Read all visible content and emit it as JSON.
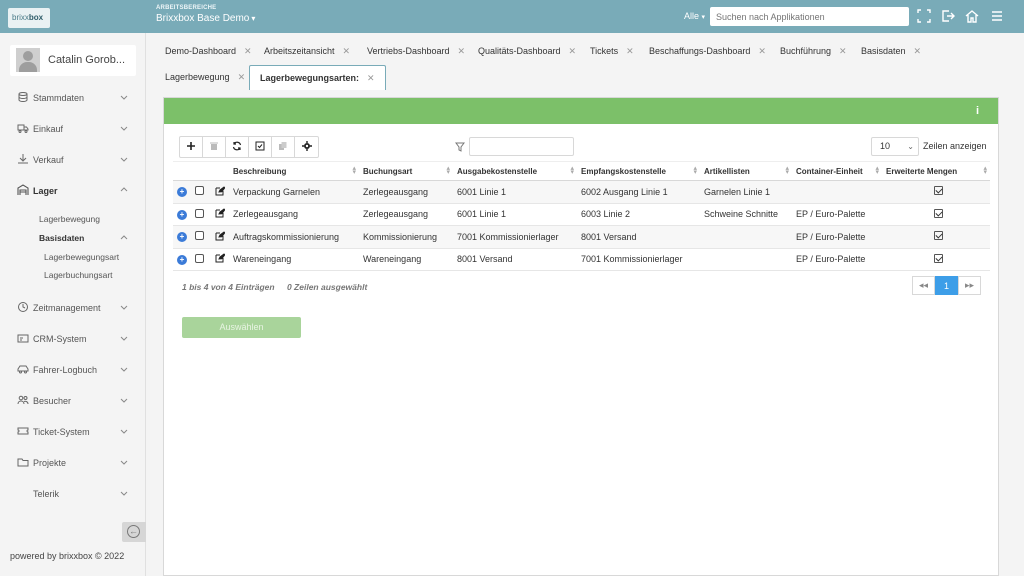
{
  "header": {
    "logo_text_light": "brixx",
    "logo_text_bold": "box",
    "workspace_label": "ARBEITSBEREICHE",
    "workspace_name": "Brixxbox Base Demo",
    "scope": "Alle",
    "search_placeholder": "Suchen nach Applikationen",
    "icons": [
      "fullscreen-icon",
      "logout-icon",
      "home-icon",
      "menu-icon"
    ]
  },
  "user": {
    "name": "Catalin Gorob..."
  },
  "sidebar": {
    "items": [
      {
        "label": "Stammdaten",
        "icon": "database-icon"
      },
      {
        "label": "Einkauf",
        "icon": "truck-icon"
      },
      {
        "label": "Verkauf",
        "icon": "hand-icon"
      },
      {
        "label": "Lager",
        "icon": "warehouse-icon"
      },
      {
        "label": "Zeitmanagement",
        "icon": "clock-icon"
      },
      {
        "label": "CRM-System",
        "icon": "card-icon"
      },
      {
        "label": "Fahrer-Logbuch",
        "icon": "car-icon"
      },
      {
        "label": "Besucher",
        "icon": "users-icon"
      },
      {
        "label": "Ticket-System",
        "icon": "ticket-icon"
      },
      {
        "label": "Projekte",
        "icon": "folder-icon"
      },
      {
        "label": "Telerik",
        "icon": ""
      }
    ],
    "sub_lager": [
      "Lagerbewegung",
      "Basisdaten"
    ],
    "sub_basisdaten": [
      "Lagerbewegungsart",
      "Lagerbuchungsart"
    ],
    "footer": "powered by brixxbox © 2022"
  },
  "tabs": [
    "Demo-Dashboard",
    "Arbeitszeitansicht",
    "Vertriebs-Dashboard",
    "Qualitäts-Dashboard",
    "Tickets",
    "Beschaffungs-Dashboard",
    "Buchführung",
    "Basisdaten",
    "Lagerbewegung",
    "Lagerbewegungsarten:"
  ],
  "table": {
    "page_size": "10",
    "page_size_label": "Zeilen anzeigen",
    "columns": [
      "Beschreibung",
      "Buchungsart",
      "Ausgabekostenstelle",
      "Empfangskostenstelle",
      "Artikellisten",
      "Container-Einheit",
      "Erweiterte Mengen"
    ],
    "rows": [
      [
        "Verpackung Garnelen",
        "Zerlegeausgang",
        "6001 Linie 1",
        "6002 Ausgang Linie 1",
        "Garnelen Linie 1",
        "",
        "checked"
      ],
      [
        "Zerlegeausgang",
        "Zerlegeausgang",
        "6001 Linie 1",
        "6003 Linie 2",
        "Schweine Schnitte",
        "EP / Euro-Palette",
        "checked"
      ],
      [
        "Auftragskommissionierung",
        "Kommissionierung",
        "7001 Kommissionierlager",
        "8001 Versand",
        "",
        "EP / Euro-Palette",
        "checked"
      ],
      [
        "Wareneingang",
        "Wareneingang",
        "8001 Versand",
        "7001 Kommissionierlager",
        "",
        "EP / Euro-Palette",
        "checked"
      ]
    ],
    "info": "1 bis 4 von 4 Einträgen",
    "selected_info": "0 Zeilen ausgewählt",
    "current_page": "1"
  },
  "select_button": "Auswählen",
  "colors": {
    "topbar": "#79abb8",
    "panel_header": "#7cc069",
    "active_page": "#3d9ee8"
  }
}
